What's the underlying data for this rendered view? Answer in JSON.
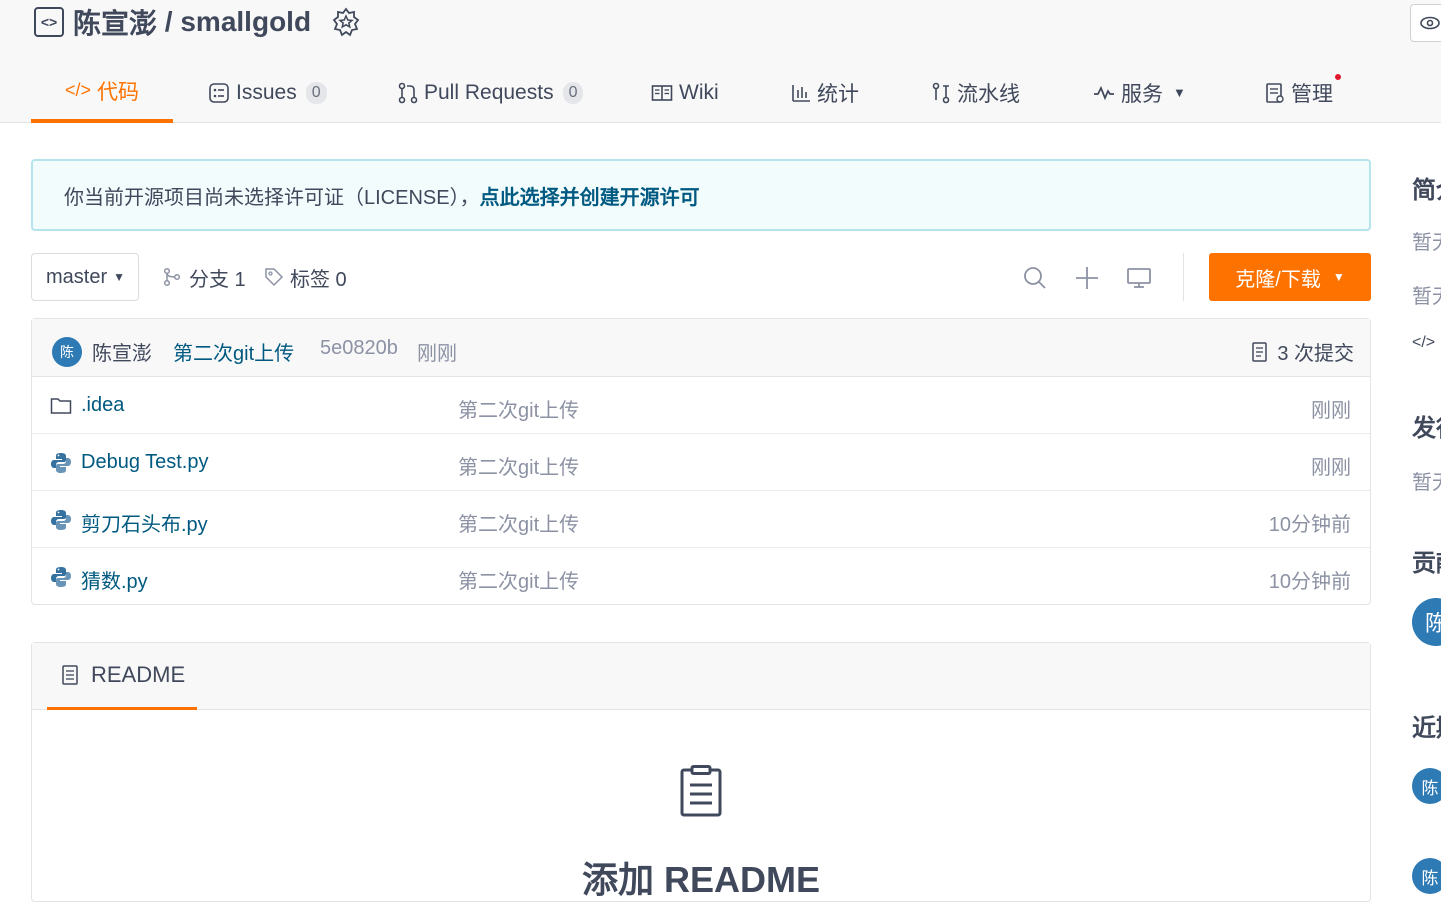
{
  "header": {
    "repo_owner": "陈宣澎",
    "separator": " / ",
    "repo_name": "smallgold"
  },
  "tabs": [
    {
      "label": "代码",
      "icon": "code-icon",
      "active": true
    },
    {
      "label": "Issues",
      "icon": "issues-icon",
      "count": "0"
    },
    {
      "label": "Pull Requests",
      "icon": "pull-request-icon",
      "count": "0"
    },
    {
      "label": "Wiki",
      "icon": "wiki-icon"
    },
    {
      "label": "统计",
      "icon": "chart-icon"
    },
    {
      "label": "流水线",
      "icon": "pipeline-icon"
    },
    {
      "label": "服务",
      "icon": "service-icon"
    },
    {
      "label": "管理",
      "icon": "manage-icon"
    }
  ],
  "notice": {
    "text": "你当前开源项目尚未选择许可证（LICENSE），",
    "link": "点此选择并创建开源许可"
  },
  "toolbar": {
    "branch": "master",
    "branches_label": "分支 1",
    "tags_label": "标签 0",
    "clone_label": "克隆/下载"
  },
  "commit": {
    "avatar_initial": "陈",
    "author": "陈宣澎",
    "message": "第二次git上传",
    "sha": "5e0820b",
    "time": "刚刚",
    "count_label": "3 次提交"
  },
  "files": [
    {
      "name": ".idea",
      "type": "folder",
      "commit": "第二次git上传",
      "time": "刚刚"
    },
    {
      "name": "Debug Test.py",
      "type": "python",
      "commit": "第二次git上传",
      "time": "刚刚"
    },
    {
      "name": "剪刀石头布.py",
      "type": "python",
      "commit": "第二次git上传",
      "time": "10分钟前"
    },
    {
      "name": "猜数.py",
      "type": "python",
      "commit": "第二次git上传",
      "time": "10分钟前"
    }
  ],
  "readme": {
    "tab_label": "README",
    "add_label": "添加 README"
  },
  "sidebar": {
    "intro_heading": "简介",
    "intro_text_1": "暂无",
    "intro_text_2": "暂无",
    "release_heading": "发行版",
    "release_text": "暂无",
    "contrib_heading": "贡献者",
    "contrib_avatar": "陈",
    "recent_heading": "近期动态",
    "recent_avatar": "陈"
  },
  "colors": {
    "accent": "#fe7300",
    "link": "#005980",
    "avatar": "#2d7ab5"
  }
}
